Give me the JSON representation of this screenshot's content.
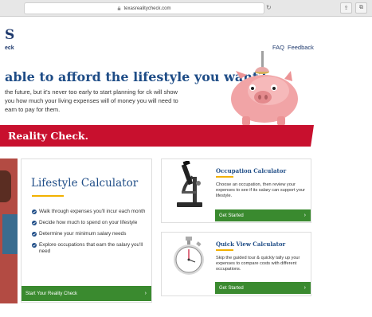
{
  "browser": {
    "url": "texasrealitycheck.com",
    "reload_glyph": "↻",
    "share_glyph": "⇪",
    "tabs_glyph": "⧉"
  },
  "header": {
    "logo_big": "S",
    "logo_small": "eck",
    "nav": [
      "FAQ",
      "Feedback"
    ]
  },
  "hero": {
    "headline": "able to afford the lifestyle you want?",
    "intro": "the future, but it's never too early to start planning for ck will show you how much your living expenses will of money you will need to earn to pay for them.",
    "banner": "Reality Check."
  },
  "lifestyle": {
    "title": "Lifestyle Calculator",
    "bullets": [
      "Walk through expenses you'll incur each month",
      "Decide how much to spend on your lifestyle",
      "Determine your minimum salary needs",
      "Explore occupations that earn the salary you'll need"
    ],
    "cta": "Start Your Reality Check",
    "cta_arrow": "›"
  },
  "occupation": {
    "title": "Occupation Calculator",
    "desc": "Choose an occupation, then review your expenses to see if its salary can support your lifestyle.",
    "cta": "Get Started",
    "cta_arrow": "›"
  },
  "quickview": {
    "title": "Quick View Calculator",
    "desc": "Skip the guided tour & quickly tally up your expenses to compare costs with different occupations.",
    "cta": "Get Started",
    "cta_arrow": "›"
  },
  "colors": {
    "brand_blue": "#1f4d87",
    "banner_red": "#c8102e",
    "cta_green": "#3a8a2f",
    "accent_gold": "#f2b100"
  }
}
